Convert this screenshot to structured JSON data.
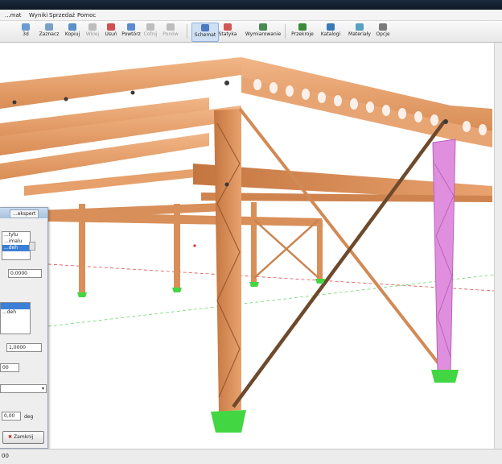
{
  "menu": {
    "items": [
      "...mat",
      "Wyniki",
      "Sprzedaż",
      "Pomoc"
    ]
  },
  "toolbar": {
    "items": [
      {
        "label": "3d",
        "name": "view-3d-button",
        "enabled": true,
        "selected": false
      },
      {
        "label": "Zaznacz",
        "name": "select-button",
        "enabled": true,
        "selected": false
      },
      {
        "label": "Kopiuj",
        "name": "copy-button",
        "enabled": true,
        "selected": false
      },
      {
        "label": "Wklej",
        "name": "paste-button",
        "enabled": false,
        "selected": false
      },
      {
        "label": "Usuń",
        "name": "delete-button",
        "enabled": true,
        "selected": false
      },
      {
        "label": "Powtórz",
        "name": "repeat-button",
        "enabled": true,
        "selected": false
      },
      {
        "label": "Cofnij",
        "name": "undo-button",
        "enabled": false,
        "selected": false
      },
      {
        "label": "Ponów",
        "name": "redo-button",
        "enabled": false,
        "selected": false
      },
      {
        "label": "Schemat",
        "name": "schema-button",
        "enabled": true,
        "selected": true
      },
      {
        "label": "Statyka",
        "name": "statics-button",
        "enabled": true,
        "selected": false
      },
      {
        "label": "Wymiarowanie",
        "name": "sizing-button",
        "enabled": true,
        "selected": false
      },
      {
        "label": "Przekroje",
        "name": "sections-button",
        "enabled": true,
        "selected": false
      },
      {
        "label": "Katalogi",
        "name": "catalogs-button",
        "enabled": true,
        "selected": false
      },
      {
        "label": "Materiały",
        "name": "materials-button",
        "enabled": true,
        "selected": false
      },
      {
        "label": "Opcje",
        "name": "options-button",
        "enabled": true,
        "selected": false
      }
    ]
  },
  "panel": {
    "tab": "...ekspert",
    "list1": [
      "...tyłu",
      "...imalu",
      "...deh"
    ],
    "value1": "0,0000",
    "list2": [
      "",
      "...deh"
    ],
    "value2": "1,0000",
    "value3": "00",
    "angle_value": "0,00",
    "angle_unit": "deg",
    "close_label": "Zamknij"
  },
  "status": {
    "text": "00"
  },
  "colors": {
    "beam": "#e7a06c",
    "beam_dark": "#b86c3c",
    "support": "#43d643",
    "highlight_column": "#e08fdf",
    "brace": "#6e4a2c"
  }
}
